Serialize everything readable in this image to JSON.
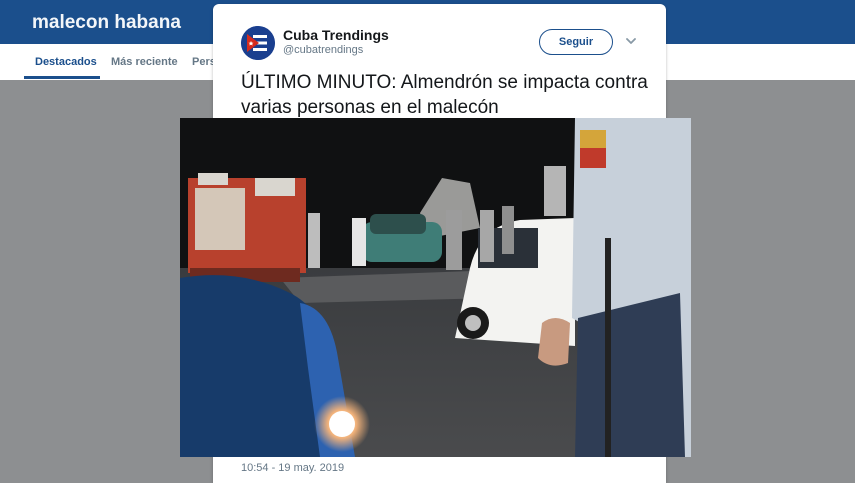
{
  "header": {
    "title": "malecon habana"
  },
  "nav": {
    "tabs": [
      {
        "label": "Destacados",
        "active": true
      },
      {
        "label": "Más reciente",
        "active": false
      },
      {
        "label": "Pers",
        "active": false
      }
    ]
  },
  "tweet": {
    "author_name": "Cuba Trendings",
    "author_handle": "@cubatrendings",
    "follow_label": "Seguir",
    "text": "ÚLTIMO MINUTO: Almendrón se impacta contra varias personas en el malecón",
    "timestamp": "10:54 - 19 may. 2019",
    "photo_icon": "night-accident-photo"
  },
  "colors": {
    "brand": "#1b4f8c",
    "overlay": "#8d8f91",
    "text_secondary": "#657786"
  }
}
